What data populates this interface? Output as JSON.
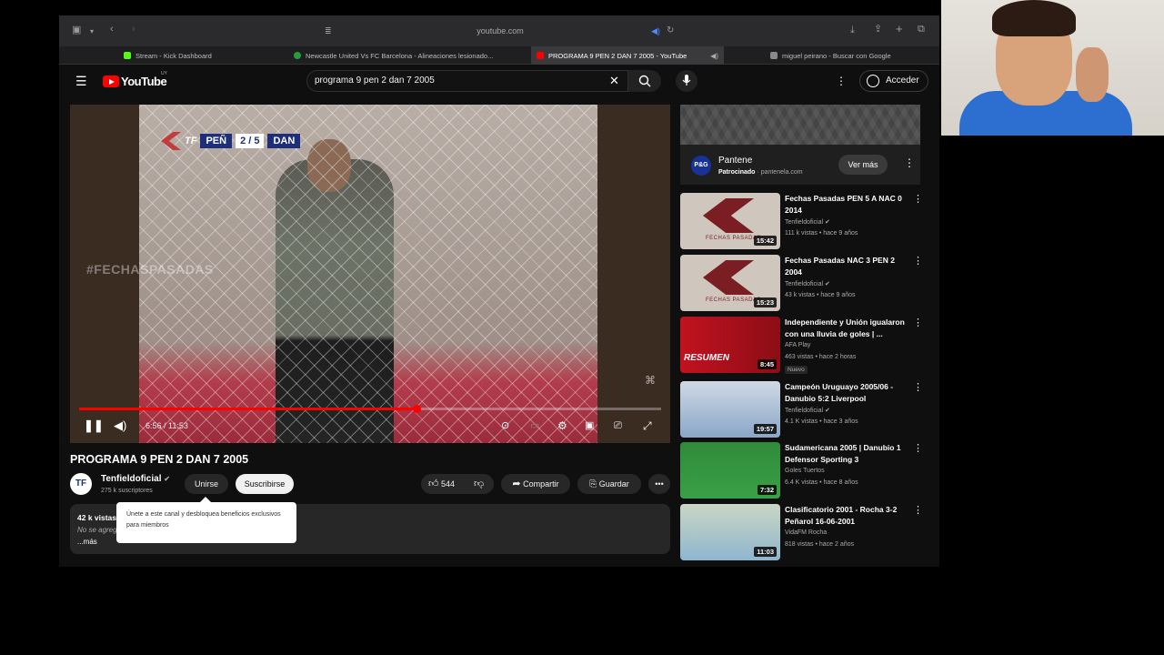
{
  "browser": {
    "url": "youtube.com",
    "tabs": [
      {
        "label": "Stream - Kick Dashboard",
        "favicon": "#53fc18"
      },
      {
        "label": "Newcastle United Vs FC Barcelona - Alineaciones lesionado...",
        "favicon": "#21a038"
      },
      {
        "label": "PROGRAMA 9 PEN 2 DAN 7 2005 - YouTube",
        "favicon": "#ff0000"
      },
      {
        "label": "miguel peirano - Buscar con Google",
        "favicon": "#8a8a8a"
      }
    ]
  },
  "yt": {
    "logo": "YouTube",
    "logo_region": "UY",
    "search_query": "programa 9 pen 2 dan 7 2005",
    "signin_label": "Acceder"
  },
  "video": {
    "score_home": "PEÑ",
    "score": "2 / 5",
    "score_away": "DAN",
    "hashtag": "#FECHASPASADAS",
    "current_time": "6:56",
    "duration": "11:53",
    "progress": 0.58,
    "title": "PROGRAMA 9 PEN 2 DAN 7 2005"
  },
  "channel": {
    "name": "Tenfieldoficial",
    "subscribers": "275 k suscriptores",
    "avatar_text": "TF",
    "join_label": "Unirse",
    "subscribe_label": "Suscribirse"
  },
  "actions": {
    "likes": "544",
    "share_label": "Compartir",
    "save_label": "Guardar"
  },
  "description": {
    "views": "42 k vistas",
    "text": "No se agreg",
    "more_label": "...más"
  },
  "tooltip": "Únete a este canal y desbloquea beneficios exclusivos para miembros",
  "ad": {
    "name": "Pantene",
    "sponsored": "Patrocinado",
    "domain": "pantenela.com",
    "cta": "Ver más",
    "logo_text": "P&G"
  },
  "recommendations": [
    {
      "title": "Fechas Pasadas PEN 5 A NAC 0 2014",
      "channel": "Tenfieldoficial",
      "verified": true,
      "meta": "111 k vistas • hace 9 años",
      "duration": "15:42",
      "thumb": "fechas",
      "caption": "FECHAS PASADAS"
    },
    {
      "title": "Fechas Pasadas NAC 3 PEN 2 2004",
      "channel": "Tenfieldoficial",
      "verified": true,
      "meta": "43 k vistas • hace 9 años",
      "duration": "15:23",
      "thumb": "fechas",
      "caption": "FECHAS PASADAS"
    },
    {
      "title": "Independiente y Unión igualaron con una lluvia de goles | ...",
      "channel": "AFA Play",
      "verified": false,
      "meta": "463 vistas • hace 2 horas",
      "duration": "8:45",
      "badge": "Nuevo",
      "thumb": "red",
      "caption": "RESUMEN"
    },
    {
      "title": "Campeón Uruguayo 2005/06 - Danubio 5:2 Liverpool",
      "channel": "Tenfieldoficial",
      "verified": true,
      "meta": "4.1 K vistas • hace 3 años",
      "duration": "19:57",
      "thumb": "blue"
    },
    {
      "title": "Sudamericana 2005 | Danubio 1 Defensor Sporting 3",
      "channel": "Goles Tuertos",
      "verified": false,
      "meta": "6.4 K vistas • hace 8 años",
      "duration": "7:32",
      "thumb": "green"
    },
    {
      "title": "Clasificatorio 2001 - Rocha 3-2 Peñarol 16-06-2001",
      "channel": "VidaFM Rocha",
      "verified": false,
      "meta": "818 vistas • hace 2 años",
      "duration": "11:03",
      "thumb": "pale"
    }
  ]
}
